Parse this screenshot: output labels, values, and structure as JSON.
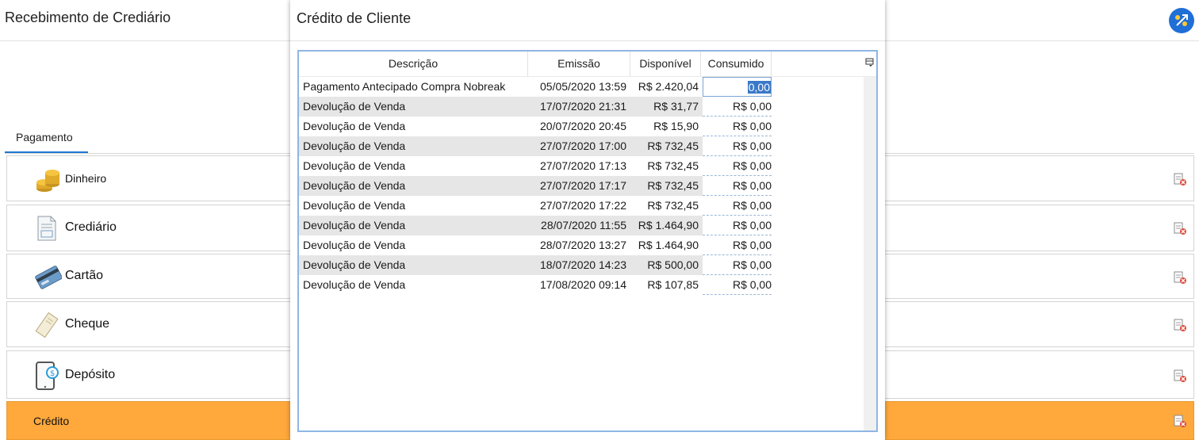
{
  "background": {
    "title": "Recebimento de Crediário",
    "tab_label": "Pagamento",
    "payment_methods": [
      {
        "label": "Dinheiro",
        "icon": "coins-icon"
      },
      {
        "label": "Crediário",
        "icon": "document-icon"
      },
      {
        "label": "Cartão",
        "icon": "credit-card-icon"
      },
      {
        "label": "Cheque",
        "icon": "cheque-icon"
      },
      {
        "label": "Depósito",
        "icon": "tablet-deposit-icon"
      },
      {
        "label": "Crédito",
        "icon": "none"
      }
    ],
    "active_color": "#ffa83c",
    "accent_color": "#1f6fd6"
  },
  "dialog": {
    "title": "Crédito de Cliente",
    "columns": [
      "Descrição",
      "Emissão",
      "Disponível",
      "Consumido"
    ],
    "rows": [
      {
        "descricao": "Pagamento Antecipado Compra Nobreak",
        "emissao": "05/05/2020 13:59",
        "disponivel": "R$ 2.420,04",
        "consumido": "0,00"
      },
      {
        "descricao": "Devolução de Venda",
        "emissao": "17/07/2020 21:31",
        "disponivel": "R$ 31,77",
        "consumido": "R$ 0,00"
      },
      {
        "descricao": "Devolução de Venda",
        "emissao": "20/07/2020 20:45",
        "disponivel": "R$ 15,90",
        "consumido": "R$ 0,00"
      },
      {
        "descricao": "Devolução de Venda",
        "emissao": "27/07/2020 17:00",
        "disponivel": "R$ 732,45",
        "consumido": "R$ 0,00"
      },
      {
        "descricao": "Devolução de Venda",
        "emissao": "27/07/2020 17:13",
        "disponivel": "R$ 732,45",
        "consumido": "R$ 0,00"
      },
      {
        "descricao": "Devolução de Venda",
        "emissao": "27/07/2020 17:17",
        "disponivel": "R$ 732,45",
        "consumido": "R$ 0,00"
      },
      {
        "descricao": "Devolução de Venda",
        "emissao": "27/07/2020 17:22",
        "disponivel": "R$ 732,45",
        "consumido": "R$ 0,00"
      },
      {
        "descricao": "Devolução de Venda",
        "emissao": "28/07/2020 11:55",
        "disponivel": "R$ 1.464,90",
        "consumido": "R$ 0,00"
      },
      {
        "descricao": "Devolução de Venda",
        "emissao": "28/07/2020 13:27",
        "disponivel": "R$ 1.464,90",
        "consumido": "R$ 0,00"
      },
      {
        "descricao": "Devolução de Venda",
        "emissao": "18/07/2020 14:23",
        "disponivel": "R$ 500,00",
        "consumido": "R$ 0,00"
      },
      {
        "descricao": "Devolução de Venda",
        "emissao": "17/08/2020 09:14",
        "disponivel": "R$ 107,85",
        "consumido": "R$ 0,00"
      }
    ]
  }
}
